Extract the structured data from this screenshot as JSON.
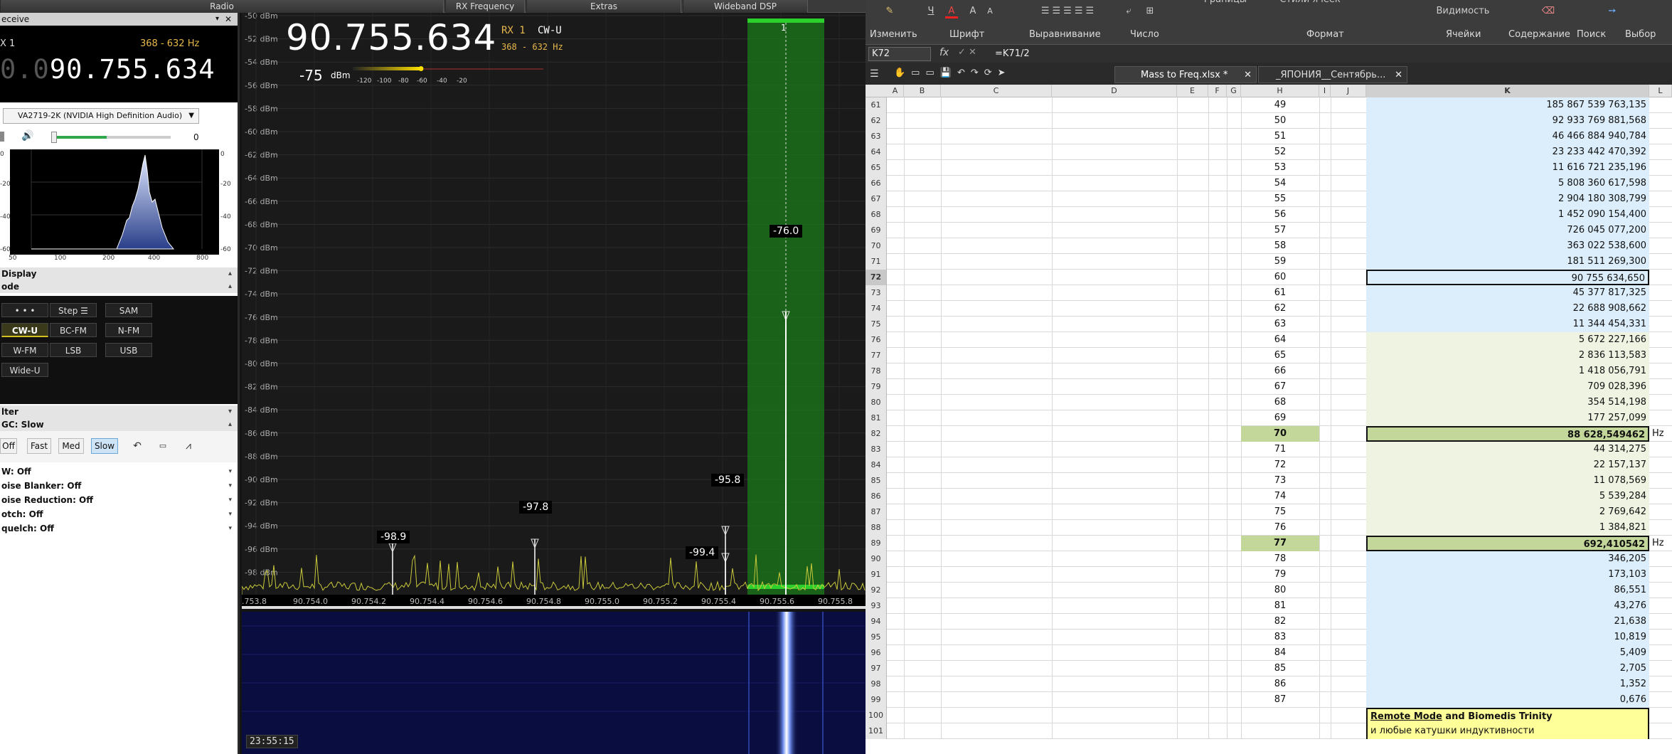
{
  "sdr": {
    "tabs": [
      "Radio",
      "RX Frequency",
      "Extras",
      "Wideband DSP"
    ],
    "left_panel": {
      "title": "eceive",
      "rx_label": "X 1",
      "bandwidth": "368 - 632 Hz",
      "freq_prefix": "0.0",
      "freq_main": "90.755.634",
      "device": "VA2719-2K (NVIDIA High Definition Audio)",
      "volume_value": "0",
      "volume_level": 0.45,
      "fft_left_ticks": [
        "0",
        "-20",
        "-40",
        "-60"
      ],
      "fft_right_ticks": [
        "0",
        "-20",
        "-40",
        "-60"
      ],
      "fft_x_ticks": [
        "50",
        "100",
        "200",
        "400",
        "800"
      ],
      "display_label": "Display",
      "mode_label": "ode",
      "modes": [
        {
          "label": "• • •",
          "selected": false
        },
        {
          "label": "Step ☰",
          "selected": false
        },
        {
          "label": "SAM",
          "selected": false
        },
        {
          "label": "CW-U",
          "selected": true
        },
        {
          "label": "BC-FM",
          "selected": false
        },
        {
          "label": "N-FM",
          "selected": false
        },
        {
          "label": "W-FM",
          "selected": false
        },
        {
          "label": "LSB",
          "selected": false
        },
        {
          "label": "USB",
          "selected": false
        },
        {
          "label": "Wide-U",
          "selected": false
        }
      ],
      "filter_label": "lter",
      "agc_label": "GC: Slow",
      "agc_buttons": [
        {
          "label": "Off",
          "selected": false
        },
        {
          "label": "Fast",
          "selected": false
        },
        {
          "label": "Med",
          "selected": false
        },
        {
          "label": "Slow",
          "selected": true
        }
      ],
      "options": [
        "W: Off",
        "oise Blanker: Off",
        "oise Reduction: Off",
        "otch: Off",
        "quelch: Off"
      ]
    },
    "spectrum": {
      "center_freq": "90.755.634",
      "rx": "RX 1",
      "mode": "CW-U",
      "bandwidth": "368 - 632 Hz",
      "signal_value": "-75",
      "signal_unit": "dBm",
      "smeter_labels": [
        "-120",
        "-100",
        "-80",
        "-60",
        "-40",
        "-20"
      ],
      "db_labels": [
        "-50 dBm",
        "-52 dBm",
        "-54 dBm",
        "-56 dBm",
        "-58 dBm",
        "-60 dBm",
        "-62 dBm",
        "-64 dBm",
        "-66 dBm",
        "-68 dBm",
        "-70 dBm",
        "-72 dBm",
        "-74 dBm",
        "-76 dBm",
        "-78 dBm",
        "-80 dBm",
        "-82 dBm",
        "-84 dBm",
        "-86 dBm",
        "-88 dBm",
        "-90 dBm",
        "-92 dBm",
        "-94 dBm",
        "-96 dBm",
        "-98 dBm"
      ],
      "peaks": [
        "-98.9",
        "-97.8",
        "-99.4",
        "-95.8",
        "-76.0"
      ],
      "channel_marker": "1",
      "freq_axis": [
        ".753.8",
        "90.754.0",
        "90.754.2",
        "90.754.4",
        "90.754.6",
        "90.754.8",
        "90.755.0",
        "90.755.2",
        "90.755.4",
        "90.755.6",
        "90.755.8"
      ],
      "waterfall_time": "23:55:15"
    }
  },
  "excel": {
    "ribbon_groups": [
      "Изменить",
      "Шрифт",
      "Выравнивание",
      "Число",
      "Формат",
      "Ячейки",
      "Содержание",
      "Поиск",
      "Выбор"
    ],
    "ribbon_labels": [
      "Ч",
      "A",
      "A",
      "A",
      "Видимость",
      "Границы",
      "Стили ячеек"
    ],
    "name_box": "K72",
    "formula": "=K71/2",
    "doc_tabs": [
      "Mass to Freq.xlsx *",
      "_ЯПОНИЯ__Сентябрь..."
    ],
    "columns": [
      "A",
      "B",
      "C",
      "D",
      "E",
      "F",
      "G",
      "H",
      "I",
      "J",
      "K",
      "L"
    ],
    "rows": [
      {
        "r": "61",
        "h": "49",
        "k": "185 867 539 763,135",
        "style": "blue"
      },
      {
        "r": "62",
        "h": "50",
        "k": "92 933 769 881,568",
        "style": "blue"
      },
      {
        "r": "63",
        "h": "51",
        "k": "46 466 884 940,784",
        "style": "blue"
      },
      {
        "r": "64",
        "h": "52",
        "k": "23 233 442 470,392",
        "style": "blue"
      },
      {
        "r": "65",
        "h": "53",
        "k": "11 616 721 235,196",
        "style": "blue"
      },
      {
        "r": "66",
        "h": "54",
        "k": "5 808 360 617,598",
        "style": "blue"
      },
      {
        "r": "67",
        "h": "55",
        "k": "2 904 180 308,799",
        "style": "blue"
      },
      {
        "r": "68",
        "h": "56",
        "k": "1 452 090 154,400",
        "style": "blue"
      },
      {
        "r": "69",
        "h": "57",
        "k": "726 045 077,200",
        "style": "blue"
      },
      {
        "r": "70",
        "h": "58",
        "k": "363 022 538,600",
        "style": "blue"
      },
      {
        "r": "71",
        "h": "59",
        "k": "181 511 269,300",
        "style": "blue"
      },
      {
        "r": "72",
        "h": "60",
        "k": "90 755 634,650",
        "style": "active"
      },
      {
        "r": "73",
        "h": "61",
        "k": "45 377 817,325",
        "style": "blue"
      },
      {
        "r": "74",
        "h": "62",
        "k": "22 688 908,662",
        "style": "blue"
      },
      {
        "r": "75",
        "h": "63",
        "k": "11 344 454,331",
        "style": "blue"
      },
      {
        "r": "76",
        "h": "64",
        "k": "5 672 227,166",
        "style": "green"
      },
      {
        "r": "77",
        "h": "65",
        "k": "2 836 113,583",
        "style": "green"
      },
      {
        "r": "78",
        "h": "66",
        "k": "1 418 056,791",
        "style": "green"
      },
      {
        "r": "79",
        "h": "67",
        "k": "709 028,396",
        "style": "green"
      },
      {
        "r": "80",
        "h": "68",
        "k": "354 514,198",
        "style": "green"
      },
      {
        "r": "81",
        "h": "69",
        "k": "177 257,099",
        "style": "green"
      },
      {
        "r": "82",
        "h": "70",
        "k": "88 628,549462",
        "style": "hi",
        "l": "Hz"
      },
      {
        "r": "83",
        "h": "71",
        "k": "44 314,275",
        "style": "green"
      },
      {
        "r": "84",
        "h": "72",
        "k": "22 157,137",
        "style": "green"
      },
      {
        "r": "85",
        "h": "73",
        "k": "11 078,569",
        "style": "green"
      },
      {
        "r": "86",
        "h": "74",
        "k": "5 539,284",
        "style": "green"
      },
      {
        "r": "87",
        "h": "75",
        "k": "2 769,642",
        "style": "green"
      },
      {
        "r": "88",
        "h": "76",
        "k": "1 384,821",
        "style": "green"
      },
      {
        "r": "89",
        "h": "77",
        "k": "692,410542",
        "style": "hi",
        "l": "Hz"
      },
      {
        "r": "90",
        "h": "78",
        "k": "346,205",
        "style": "blue"
      },
      {
        "r": "91",
        "h": "79",
        "k": "173,103",
        "style": "blue"
      },
      {
        "r": "92",
        "h": "80",
        "k": "86,551",
        "style": "blue"
      },
      {
        "r": "93",
        "h": "81",
        "k": "43,276",
        "style": "blue"
      },
      {
        "r": "94",
        "h": "82",
        "k": "21,638",
        "style": "blue"
      },
      {
        "r": "95",
        "h": "83",
        "k": "10,819",
        "style": "blue"
      },
      {
        "r": "96",
        "h": "84",
        "k": "5,409",
        "style": "blue"
      },
      {
        "r": "97",
        "h": "85",
        "k": "2,705",
        "style": "blue"
      },
      {
        "r": "98",
        "h": "86",
        "k": "1,352",
        "style": "blue"
      },
      {
        "r": "99",
        "h": "87",
        "k": "0,676",
        "style": "blue"
      }
    ],
    "note_title_u": "Remote Mode",
    "note_title_rest": " and Biomedis Trinity",
    "note_sub": "и любые катушки индуктивности",
    "note_rows": [
      "100",
      "101"
    ]
  },
  "colors": {
    "spectrum_trace": "#c8c83a",
    "channel_green": "#1fae2a",
    "excel_blue": "#dceefb",
    "excel_green_hl": "#c4d79b",
    "note_yellow": "#ffff99"
  }
}
